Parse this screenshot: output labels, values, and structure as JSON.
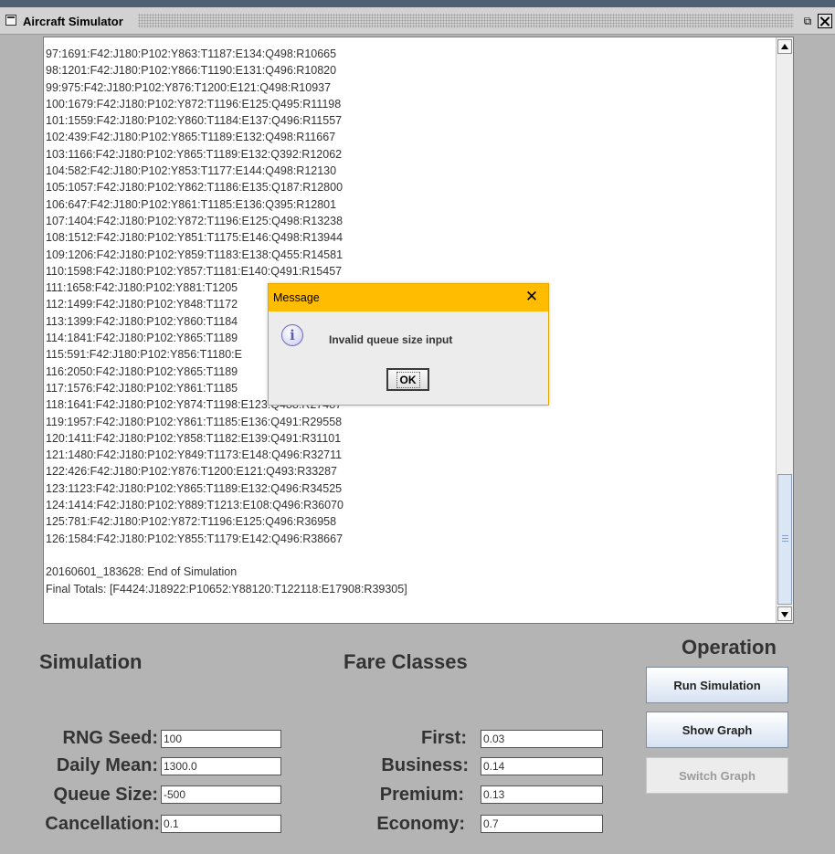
{
  "window": {
    "title": "Aircraft Simulator"
  },
  "output": {
    "lines": [
      "97:1691:F42:J180:P102:Y863:T1187:E134:Q498:R10665",
      "98:1201:F42:J180:P102:Y866:T1190:E131:Q496:R10820",
      "99:975:F42:J180:P102:Y876:T1200:E121:Q498:R10937",
      "100:1679:F42:J180:P102:Y872:T1196:E125:Q495:R11198",
      "101:1559:F42:J180:P102:Y860:T1184:E137:Q496:R11557",
      "102:439:F42:J180:P102:Y865:T1189:E132:Q498:R11667",
      "103:1166:F42:J180:P102:Y865:T1189:E132:Q392:R12062",
      "104:582:F42:J180:P102:Y853:T1177:E144:Q498:R12130",
      "105:1057:F42:J180:P102:Y862:T1186:E135:Q187:R12800",
      "106:647:F42:J180:P102:Y861:T1185:E136:Q395:R12801",
      "107:1404:F42:J180:P102:Y872:T1196:E125:Q498:R13238",
      "108:1512:F42:J180:P102:Y851:T1175:E146:Q498:R13944",
      "109:1206:F42:J180:P102:Y859:T1183:E138:Q455:R14581",
      "110:1598:F42:J180:P102:Y857:T1181:E140:Q491:R15457",
      "111:1658:F42:J180:P102:Y881:T1205",
      "112:1499:F42:J180:P102:Y848:T1172",
      "113:1399:F42:J180:P102:Y860:T1184",
      "114:1841:F42:J180:P102:Y865:T1189",
      "115:591:F42:J180:P102:Y856:T1180:E",
      "116:2050:F42:J180:P102:Y865:T1189",
      "117:1576:F42:J180:P102:Y861:T1185",
      "118:1641:F42:J180:P102:Y874:T1198:E123:Q488:R27487",
      "119:1957:F42:J180:P102:Y861:T1185:E136:Q491:R29558",
      "120:1411:F42:J180:P102:Y858:T1182:E139:Q491:R31101",
      "121:1480:F42:J180:P102:Y849:T1173:E148:Q496:R32711",
      "122:426:F42:J180:P102:Y876:T1200:E121:Q493:R33287",
      "123:1123:F42:J180:P102:Y865:T1189:E132:Q496:R34525",
      "124:1414:F42:J180:P102:Y889:T1213:E108:Q496:R36070",
      "125:781:F42:J180:P102:Y872:T1196:E125:Q496:R36958",
      "126:1584:F42:J180:P102:Y855:T1179:E142:Q496:R38667",
      "",
      "20160601_183628: End of Simulation",
      "Final Totals: [F4424:J18922:P10652:Y88120:T122118:E17908:R39305]"
    ]
  },
  "simulation": {
    "title": "Simulation",
    "rng_seed_label": "RNG Seed:",
    "rng_seed_value": "100",
    "daily_mean_label": "Daily Mean:",
    "daily_mean_value": "1300.0",
    "queue_size_label": "Queue Size:",
    "queue_size_value": "-500",
    "cancellation_label": "Cancellation:",
    "cancellation_value": "0.1"
  },
  "fare_classes": {
    "title": "Fare Classes",
    "first_label": "First:",
    "first_value": "0.03",
    "business_label": "Business:",
    "business_value": "0.14",
    "premium_label": "Premium:",
    "premium_value": "0.13",
    "economy_label": "Economy:",
    "economy_value": "0.7"
  },
  "operation": {
    "title": "Operation",
    "run_label": "Run Simulation",
    "show_graph_label": "Show Graph",
    "switch_graph_label": "Switch Graph"
  },
  "dialog": {
    "title": "Message",
    "close_glyph": "✕",
    "icon_glyph": "i",
    "message": "Invalid queue size input",
    "ok_label": "OK",
    "accent_color": "#ffbc00"
  },
  "colors": {
    "background": "#b4b4b4",
    "button_gradient_end": "#d6e2f2"
  }
}
